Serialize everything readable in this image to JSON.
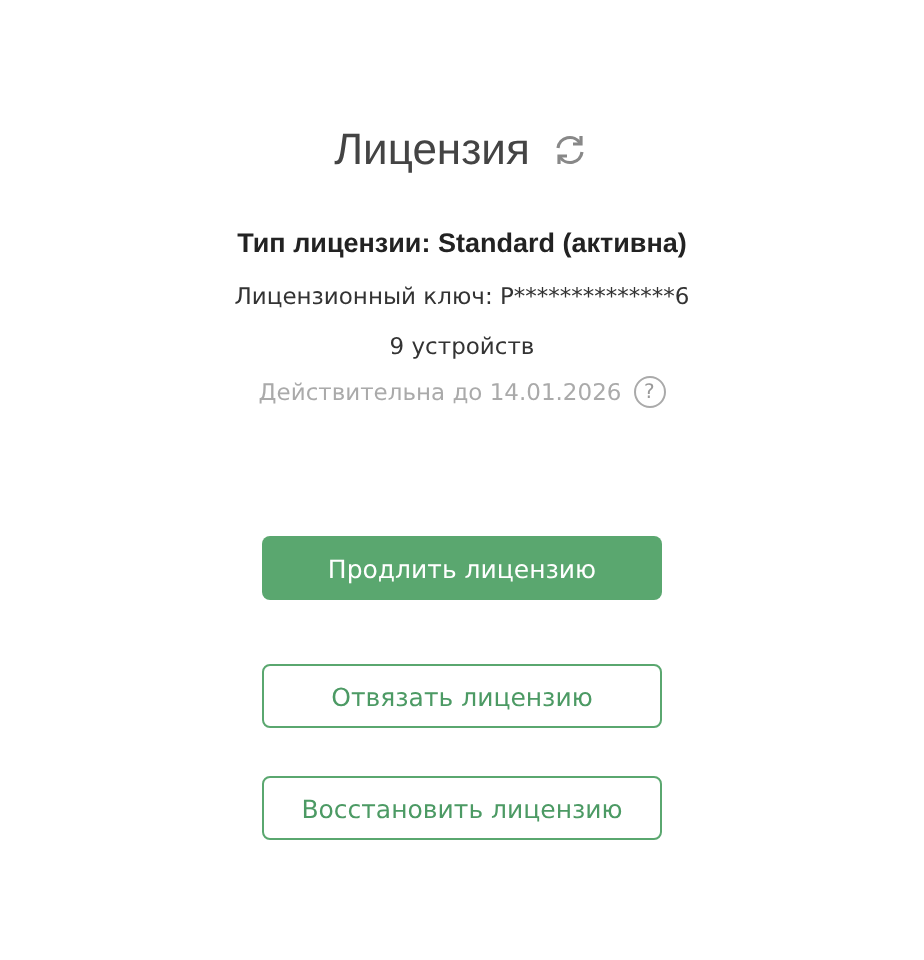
{
  "title": "Лицензия",
  "license_type": "Тип лицензии: Standard (активна)",
  "license_key": "Лицензионный ключ: P**************6",
  "devices": "9 устройств",
  "valid_until": "Действительна до 14.01.2026",
  "help": "?",
  "buttons": [
    {
      "label": "Продлить лицензию",
      "kind": "primary"
    },
    {
      "label": "Отвязать лицензию",
      "kind": "outline"
    },
    {
      "label": "Восстановить лицензию",
      "kind": "outline"
    }
  ]
}
